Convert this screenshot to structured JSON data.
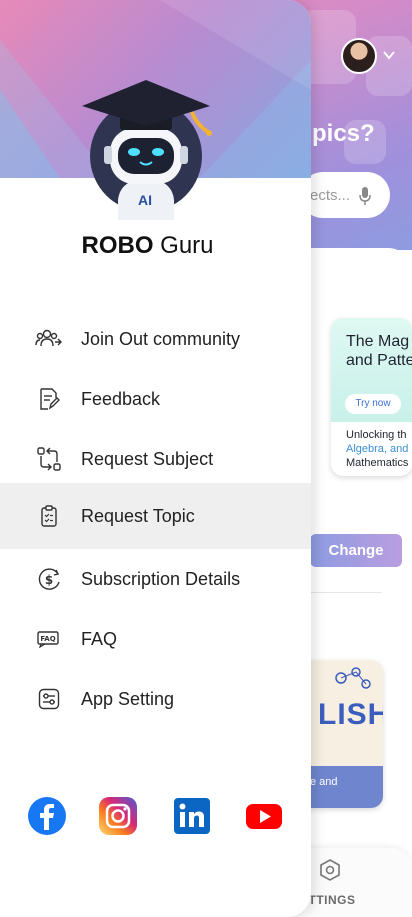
{
  "background": {
    "title_fragment": "pics?",
    "search_placeholder_fragment": "ects...",
    "card": {
      "title": "The Mag and Patte",
      "try_label": "Try now",
      "desc_line1": "Unlocking th",
      "desc_line2": "Algebra, and",
      "desc_line3": "Mathematics"
    },
    "change_label": "Change",
    "english_card": {
      "word": "LISH",
      "text": "e and"
    },
    "nav_label": "ETTINGS"
  },
  "drawer": {
    "robot_badge": "AI",
    "app_name_bold": "ROBO",
    "app_name_rest": " Guru",
    "menu": [
      {
        "label": "Join Out community",
        "icon": "community-icon",
        "active": false
      },
      {
        "label": "Feedback",
        "icon": "feedback-icon",
        "active": false
      },
      {
        "label": "Request Subject",
        "icon": "request-subject-icon",
        "active": false
      },
      {
        "label": "Request Topic",
        "icon": "request-topic-icon",
        "active": true
      },
      {
        "label": "Subscription Details",
        "icon": "subscription-icon",
        "active": false
      },
      {
        "label": "FAQ",
        "icon": "faq-icon",
        "active": false
      },
      {
        "label": "App Setting",
        "icon": "app-setting-icon",
        "active": false
      }
    ],
    "socials": [
      "facebook-icon",
      "instagram-icon",
      "linkedin-icon",
      "youtube-icon"
    ]
  },
  "colors": {
    "header_pink": "#e88ab8",
    "header_blue": "#86a7e0",
    "active_row": "#efefef",
    "facebook": "#1877f2",
    "linkedin": "#0a66c2",
    "youtube": "#ff0000"
  }
}
